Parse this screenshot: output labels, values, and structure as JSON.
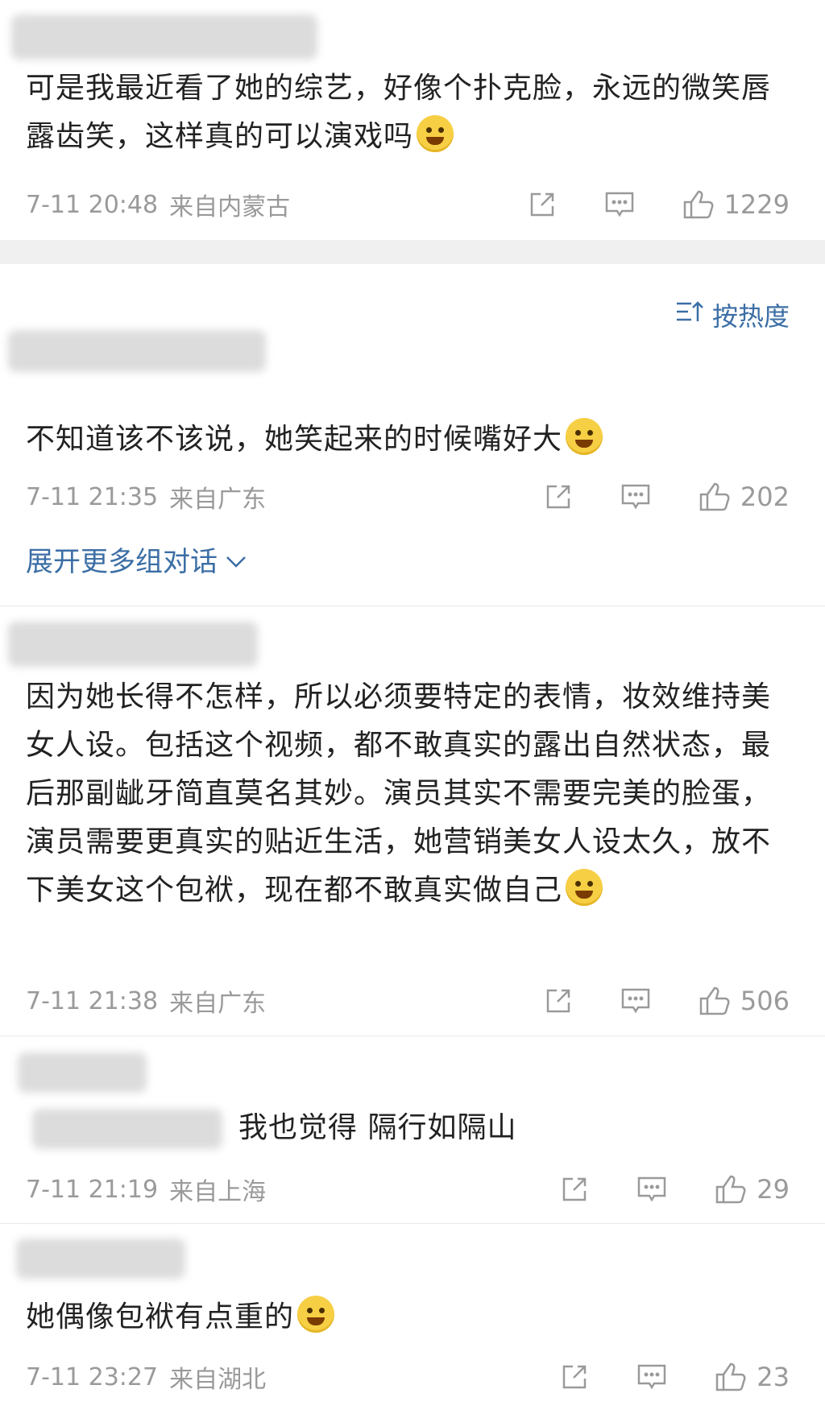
{
  "comments": [
    {
      "text": "可是我最近看了她的综艺，好像个扑克脸，永远的微笑唇露齿笑，这样真的可以演戏吗",
      "emoji": "thinking-emoji",
      "time": "7-11 20:48",
      "source": "来自内蒙古",
      "likes": "1229"
    },
    {
      "text": "不知道该不该说，她笑起来的时候嘴好大",
      "emoji": "crying-emoji",
      "time": "7-11 21:35",
      "source": "来自广东",
      "likes": "202"
    },
    {
      "text": "因为她长得不怎样，所以必须要特定的表情，妆效维持美女人设。包括这个视频，都不敢真实的露出自然状态，最后那副龇牙简直莫名其妙。演员其实不需要完美的脸蛋，演员需要更真实的贴近生活，她营销美女人设太久，放不下美女这个包袱，现在都不敢真实做自己",
      "emoji": "laughing-emoji",
      "time": "7-11 21:38",
      "source": "来自广东",
      "likes": "506"
    },
    {
      "text": "我也觉得 隔行如隔山",
      "time": "7-11 21:19",
      "source": "来自上海",
      "likes": "29"
    },
    {
      "text": "她偶像包袱有点重的",
      "emoji": "laughing-tears-emoji",
      "time": "7-11 23:27",
      "source": "来自湖北",
      "likes": "23"
    }
  ],
  "sort_label": "按热度",
  "expand_label": "展开更多组对话",
  "colors": {
    "link": "#3b6ea5",
    "meta": "#9a9a9a",
    "band": "#f0f0f0"
  },
  "icons": [
    "share-icon",
    "comment-icon",
    "like-icon",
    "sort-icon",
    "chevron-down-icon"
  ]
}
